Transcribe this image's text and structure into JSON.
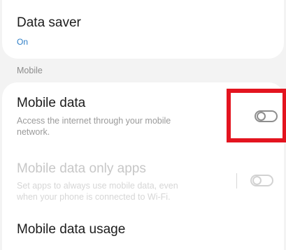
{
  "data_saver": {
    "title": "Data saver",
    "status": "On",
    "accent_color": "#2f7fc7"
  },
  "section": {
    "header": "Mobile"
  },
  "mobile_data": {
    "title": "Mobile data",
    "description_line1": "Access the internet through your mobile",
    "description_line2": "network.",
    "toggle_state": "off"
  },
  "mobile_data_only_apps": {
    "title": "Mobile data only apps",
    "description_line1": "Set apps to always use mobile data, even",
    "description_line2": "when your phone is connected to Wi-Fi.",
    "toggle_state": "off",
    "enabled": false
  },
  "mobile_data_usage": {
    "title": "Mobile data usage"
  },
  "highlight_color": "#e3141f"
}
